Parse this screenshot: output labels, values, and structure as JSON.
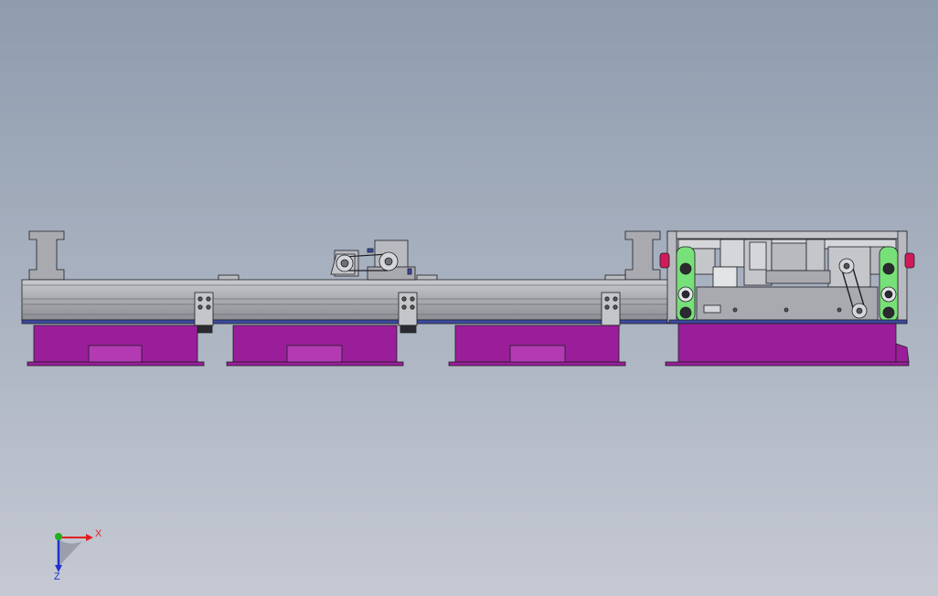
{
  "viewport": {
    "background_top": "#8e9cae",
    "background_bottom": "#c5c9d3"
  },
  "model": {
    "colors": {
      "base_magenta": "#9a1e9a",
      "base_magenta_light": "#b43ab4",
      "frame_gray": "#a8aab0",
      "frame_gray_dark": "#8c8e94",
      "steel_light": "#d4d6da",
      "rail_blue": "#3b4aa0",
      "roller_green": "#78e078",
      "endcap_pink": "#d01a5a",
      "outline": "#1f1f24"
    }
  },
  "triad": {
    "x_label": "X",
    "z_label": "Z",
    "x_color": "#e02020",
    "y_color": "#20b020",
    "z_color": "#2030d0"
  }
}
